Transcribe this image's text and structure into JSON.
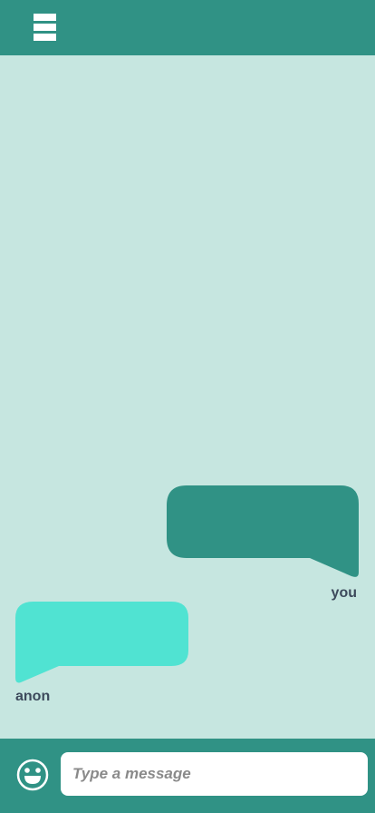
{
  "header": {
    "menu_icon": "hamburger-menu-icon"
  },
  "colors": {
    "header_bg": "#309285",
    "chat_bg": "#c6e6e0",
    "bubble_you": "#309285",
    "bubble_anon": "#50e3d2",
    "sender_label": "#3d4a5c"
  },
  "messages": [
    {
      "sender": "you",
      "text": ""
    },
    {
      "sender": "anon",
      "text": ""
    }
  ],
  "composer": {
    "emoji_icon": "smiley-face-icon",
    "placeholder": "Type a message",
    "value": ""
  }
}
